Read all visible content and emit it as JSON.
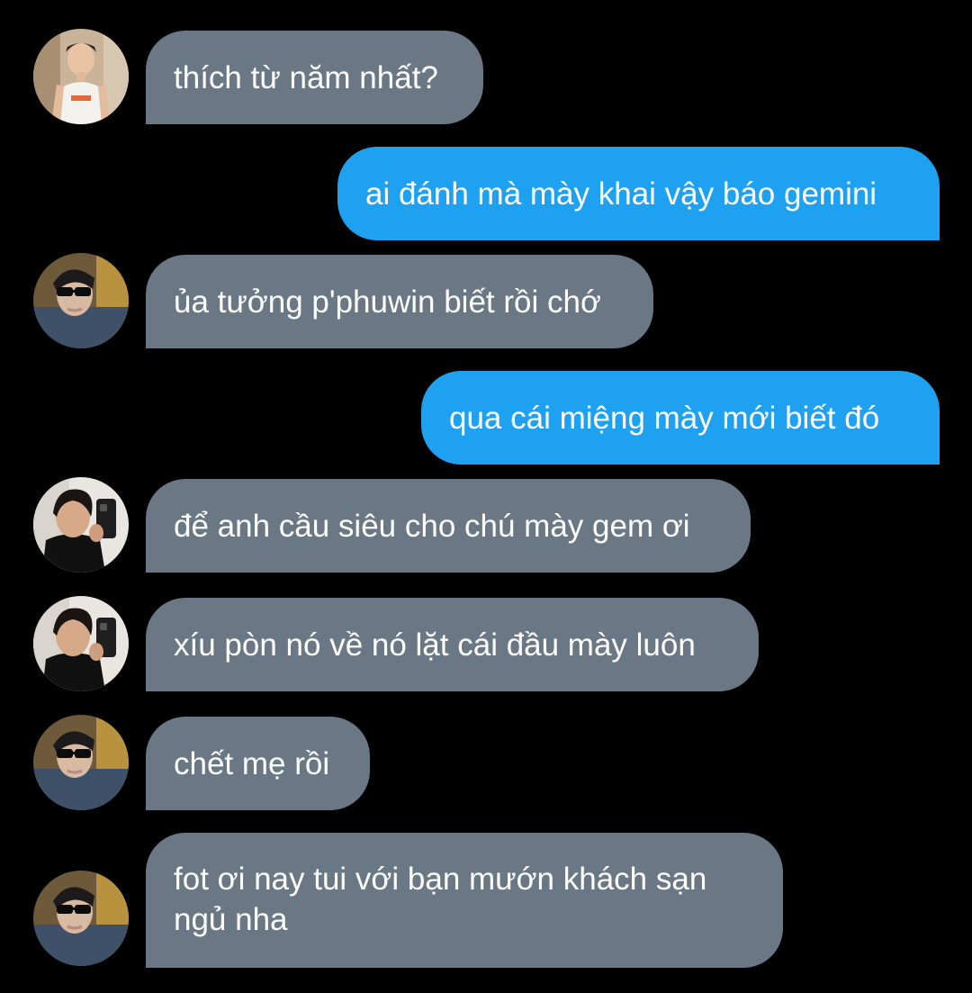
{
  "colors": {
    "background": "#000000",
    "incoming_bubble": "#6a7784",
    "outgoing_bubble": "#1ea1f1",
    "text": "#ffffff"
  },
  "messages": [
    {
      "sender": "contact-a",
      "direction": "incoming",
      "avatar": "tank-top-user-avatar",
      "text": "thích từ năm nhất?"
    },
    {
      "sender": "me",
      "direction": "outgoing",
      "text": "ai đánh mà mày khai vậy báo gemini"
    },
    {
      "sender": "contact-b",
      "direction": "incoming",
      "avatar": "sunglasses-user-avatar",
      "text": "ủa tưởng p'phuwin biết rồi chớ"
    },
    {
      "sender": "me",
      "direction": "outgoing",
      "text": "qua cái miệng mày mới biết đó"
    },
    {
      "sender": "contact-c",
      "direction": "incoming",
      "avatar": "mirror-selfie-user-avatar",
      "text": "để anh cầu siêu cho chú mày gem ơi"
    },
    {
      "sender": "contact-c",
      "direction": "incoming",
      "avatar": "mirror-selfie-user-avatar",
      "text": "xíu pòn nó về nó lặt cái đầu mày luôn"
    },
    {
      "sender": "contact-b",
      "direction": "incoming",
      "avatar": "sunglasses-user-avatar",
      "text": "chết mẹ rồi"
    },
    {
      "sender": "contact-b",
      "direction": "incoming",
      "avatar": "sunglasses-user-avatar",
      "text": "fot ơi nay tui với bạn mướn khách sạn\nngủ nha"
    }
  ]
}
